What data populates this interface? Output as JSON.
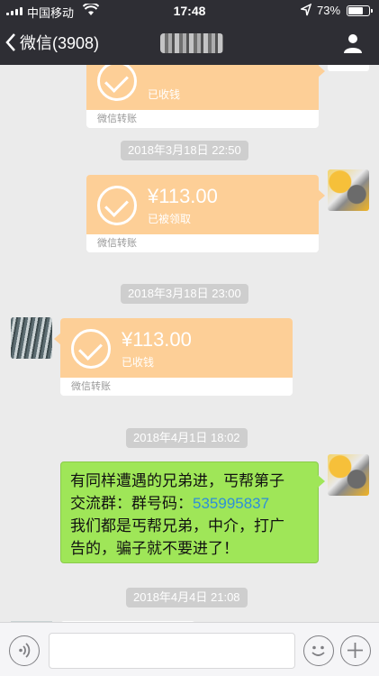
{
  "status_bar": {
    "carrier": "中国移动",
    "time": "17:48",
    "battery": "73%",
    "battery_level": 0.73
  },
  "nav": {
    "back_label": "微信(3908)"
  },
  "messages": {
    "transfer1": {
      "amount": "",
      "status": "已收钱",
      "footer": "微信转账"
    },
    "time1": "2018年3月18日 22:50",
    "transfer2": {
      "amount": "¥113.00",
      "status": "已被领取",
      "footer": "微信转账"
    },
    "time2": "2018年3月18日 23:00",
    "transfer3": {
      "amount": "¥113.00",
      "status": "已收钱",
      "footer": "微信转账"
    },
    "time3": "2018年4月1日 18:02",
    "text_bubble": {
      "line1": "有同样遭遇的兄弟进，丐帮第子",
      "line2_prefix": "交流群：群号码：",
      "line2_number": "535995837",
      "line3": "我们都是丐帮兄弟，中介，打广",
      "line4": "告的，骗子就不要进了！"
    },
    "time4": "2018年4月4日 21:08"
  },
  "colors": {
    "transfer_orange": "#fdcf97",
    "bubble_green": "#9fe658",
    "nav_dark": "#2e2e34",
    "link_blue": "#2e8fd9"
  }
}
